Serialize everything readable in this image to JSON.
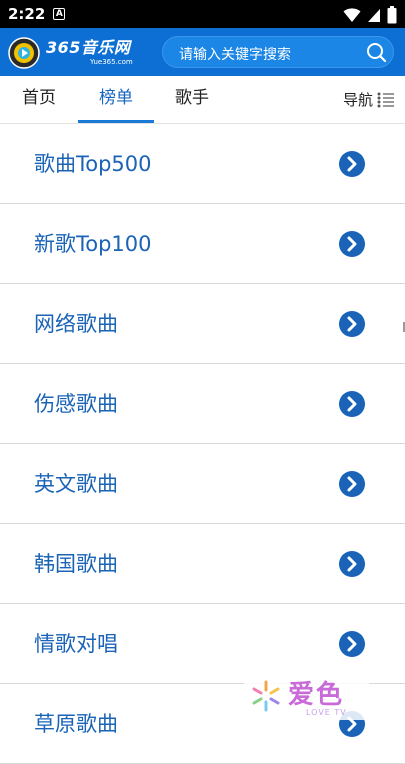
{
  "status_bar": {
    "time": "2:22",
    "app_icon_letter": "A"
  },
  "header": {
    "logo_main": "365音乐网",
    "logo_sub": "Yue365.com",
    "search_placeholder": "请输入关键字搜索"
  },
  "nav": {
    "tabs": [
      {
        "label": "首页"
      },
      {
        "label": "榜单"
      },
      {
        "label": "歌手"
      }
    ],
    "active_tab": "榜单",
    "guide_label": "导航"
  },
  "list": {
    "items": [
      {
        "label": "歌曲Top500"
      },
      {
        "label": "新歌Top100"
      },
      {
        "label": "网络歌曲"
      },
      {
        "label": "伤感歌曲"
      },
      {
        "label": "英文歌曲"
      },
      {
        "label": "韩国歌曲"
      },
      {
        "label": "情歌对唱"
      },
      {
        "label": "草原歌曲"
      }
    ]
  },
  "watermark": {
    "text": "爱色",
    "sub": "LOVE TV"
  },
  "colors": {
    "header_bg": "#0d6fd3",
    "accent": "#1766c0",
    "arrow_circle": "#1a63b7"
  }
}
